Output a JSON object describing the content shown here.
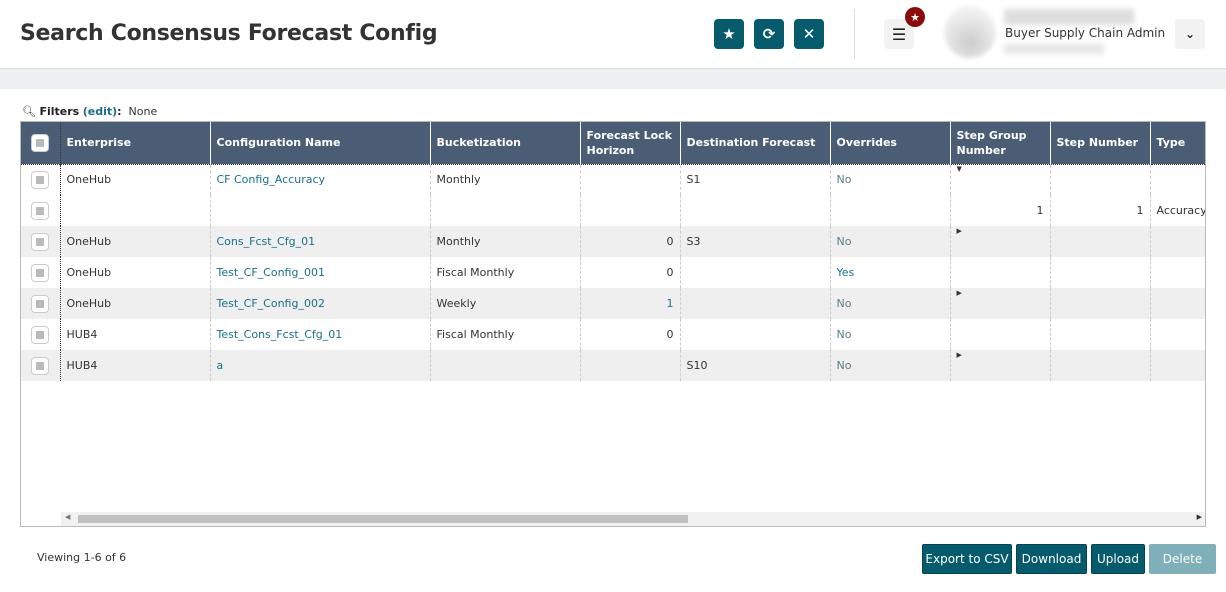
{
  "header": {
    "title": "Search Consensus Forecast Config",
    "user_role": "Buyer Supply Chain Admin"
  },
  "icons": {
    "favorite": "star-icon",
    "refresh": "refresh-icon",
    "close": "close-icon",
    "menu": "hamburger-icon",
    "badge": "star-icon",
    "dropdown": "chevron-down-icon"
  },
  "filters": {
    "label": "Filters",
    "edit": "(edit)",
    "colon": ":",
    "value": "None"
  },
  "table": {
    "columns": [
      "Enterprise",
      "Configuration Name",
      "Bucketization",
      "Forecast Lock Horizon",
      "Destination Forecast",
      "Overrides",
      "Step Group Number",
      "Step Number",
      "Type"
    ],
    "rows": [
      {
        "enterprise": "OneHub",
        "config": "CF Config_Accuracy",
        "bucket": "Monthly",
        "flh": "",
        "dest": "S1",
        "overrides": "No",
        "sgn": "",
        "sn": "",
        "type": "",
        "expanded": true
      },
      {
        "enterprise": "",
        "config": "",
        "bucket": "",
        "flh": "",
        "dest": "",
        "overrides": "",
        "sgn": "1",
        "sn": "1",
        "type": "Accuracy"
      },
      {
        "enterprise": "OneHub",
        "config": "Cons_Fcst_Cfg_01",
        "bucket": "Monthly",
        "flh": "0",
        "dest": "S3",
        "overrides": "No",
        "sgn": "",
        "sn": "",
        "type": ""
      },
      {
        "enterprise": "OneHub",
        "config": "Test_CF_Config_001",
        "bucket": "Fiscal Monthly",
        "flh": "0",
        "dest": "",
        "overrides": "Yes",
        "sgn": "",
        "sn": "",
        "type": ""
      },
      {
        "enterprise": "OneHub",
        "config": "Test_CF_Config_002",
        "bucket": "Weekly",
        "flh": "1",
        "dest": "",
        "overrides": "No",
        "sgn": "",
        "sn": "",
        "type": ""
      },
      {
        "enterprise": "HUB4",
        "config": "Test_Cons_Fcst_Cfg_01",
        "bucket": "Fiscal Monthly",
        "flh": "0",
        "dest": "",
        "overrides": "No",
        "sgn": "",
        "sn": "",
        "type": ""
      },
      {
        "enterprise": "HUB4",
        "config": "a",
        "bucket": "",
        "flh": "",
        "dest": "S10",
        "overrides": "No",
        "sgn": "",
        "sn": "",
        "type": ""
      }
    ]
  },
  "footer": {
    "viewing": "Viewing 1-6 of 6",
    "export": "Export to CSV",
    "download": "Download",
    "upload": "Upload",
    "delete": "Delete"
  }
}
